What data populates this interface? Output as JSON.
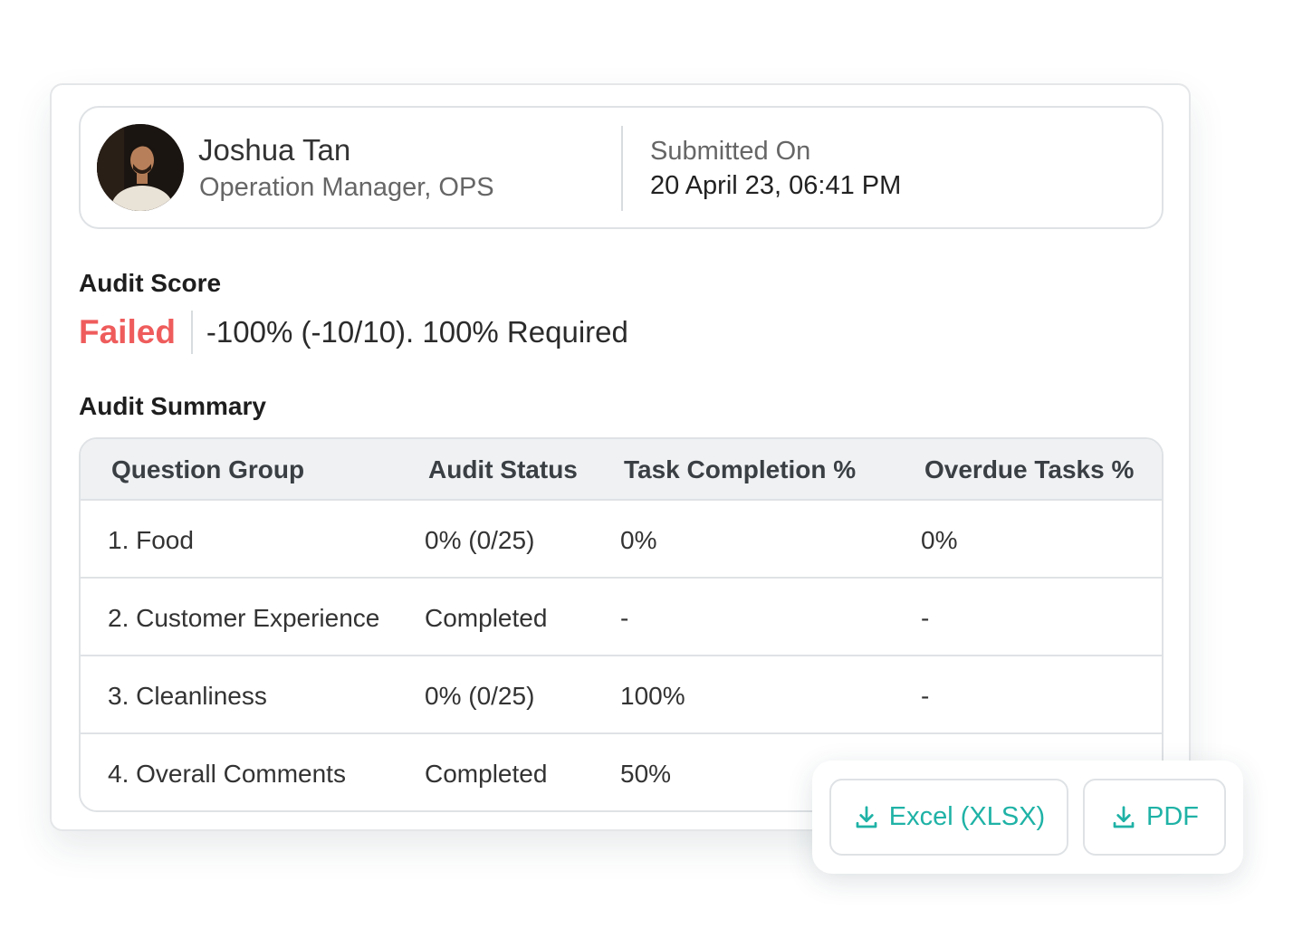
{
  "profile": {
    "name": "Joshua Tan",
    "role": "Operation Manager, OPS",
    "submitted_label": "Submitted On",
    "submitted_value": "20 April 23, 06:41 PM"
  },
  "audit_score": {
    "title": "Audit Score",
    "status": "Failed",
    "detail": "-100% (-10/10). 100% Required",
    "status_color": "#ef5c5c"
  },
  "audit_summary": {
    "title": "Audit Summary",
    "columns": [
      "Question Group",
      "Audit Status",
      "Task Completion %",
      "Overdue Tasks %"
    ],
    "rows": [
      [
        "1. Food",
        "0% (0/25)",
        "0%",
        "0%"
      ],
      [
        "2. Customer Experience",
        "Completed",
        "-",
        "-"
      ],
      [
        "3. Cleanliness",
        "0% (0/25)",
        "100%",
        "-"
      ],
      [
        "4. Overall Comments",
        "Completed",
        "50%",
        ""
      ]
    ]
  },
  "export": {
    "excel_label": "Excel (XLSX)",
    "pdf_label": "PDF",
    "icon": "download-icon",
    "accent_color": "#1fb2a6"
  }
}
